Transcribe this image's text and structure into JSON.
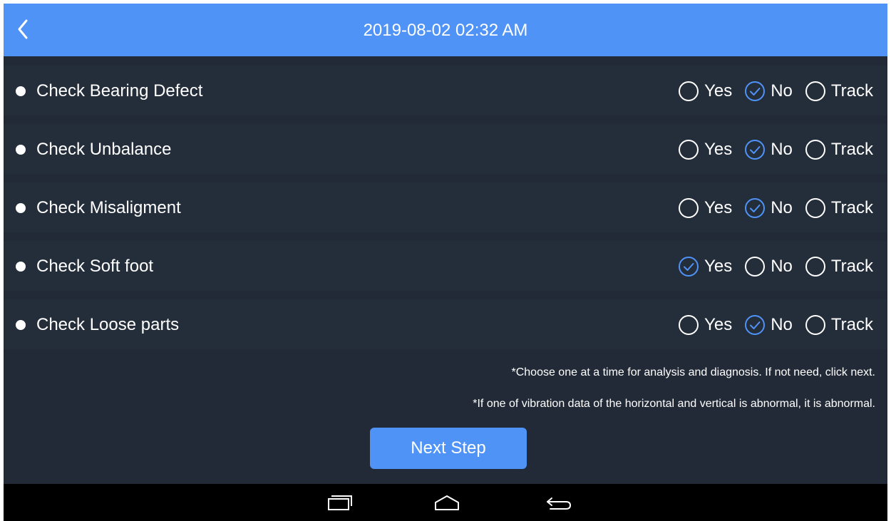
{
  "header": {
    "title": "2019-08-02 02:32 AM",
    "back_icon": "chevron-left-icon"
  },
  "checks": [
    {
      "label": "Check Bearing Defect",
      "options": [
        {
          "label": "Yes",
          "selected": false
        },
        {
          "label": "No",
          "selected": true
        },
        {
          "label": "Track",
          "selected": false
        }
      ]
    },
    {
      "label": "Check Unbalance",
      "options": [
        {
          "label": "Yes",
          "selected": false
        },
        {
          "label": "No",
          "selected": true
        },
        {
          "label": "Track",
          "selected": false
        }
      ]
    },
    {
      "label": "Check Misaligment",
      "options": [
        {
          "label": "Yes",
          "selected": false
        },
        {
          "label": "No",
          "selected": true
        },
        {
          "label": "Track",
          "selected": false
        }
      ]
    },
    {
      "label": "Check Soft foot",
      "options": [
        {
          "label": "Yes",
          "selected": true
        },
        {
          "label": "No",
          "selected": false
        },
        {
          "label": "Track",
          "selected": false
        }
      ]
    },
    {
      "label": "Check Loose parts",
      "options": [
        {
          "label": "Yes",
          "selected": false
        },
        {
          "label": "No",
          "selected": true
        },
        {
          "label": "Track",
          "selected": false
        }
      ]
    }
  ],
  "notes": {
    "note1": "*Choose one at a time for analysis and diagnosis. If not need, click next.",
    "note2": "*If one of vibration data of the horizontal and vertical is abnormal, it is abnormal."
  },
  "next_button": {
    "label": "Next Step"
  },
  "navbar": {
    "recent_icon": "recent-apps-icon",
    "home_icon": "home-icon",
    "back_icon": "back-arrow-icon"
  },
  "colors": {
    "accent": "#4f93f7",
    "background": "#222a37",
    "row_band": "#242d3a",
    "navbar": "#000000",
    "text": "#ffffff"
  }
}
